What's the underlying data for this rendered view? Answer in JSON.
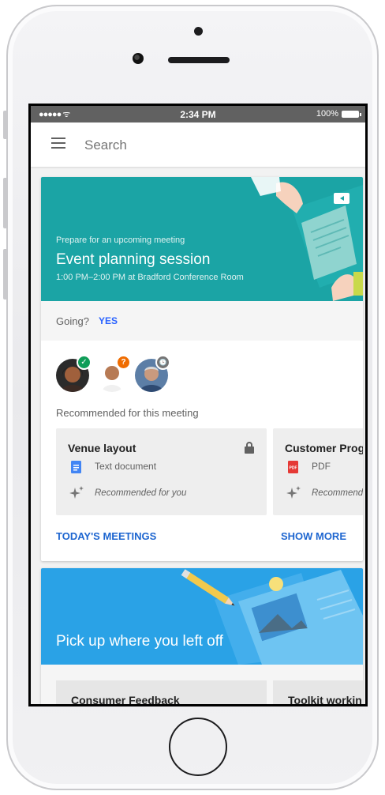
{
  "status_bar": {
    "signal": "●●●●● ᯤ",
    "time": "2:34 PM",
    "battery_pct": "100%"
  },
  "search": {
    "placeholder": "Search"
  },
  "meeting_card": {
    "kicker": "Prepare for an upcoming meeting",
    "title": "Event planning session",
    "subtitle": "1:00 PM–2:00 PM at Bradford Conference Room",
    "going_label": "Going?",
    "going_value": "YES",
    "attendee_badges": [
      "✓",
      "?",
      "🕒"
    ],
    "recommended_label": "Recommended for this meeting",
    "documents": [
      {
        "title": "Venue layout",
        "type": "Text document",
        "note": "Recommended for you",
        "type_icon": "docs-icon",
        "locked": true
      },
      {
        "title": "Customer Prog",
        "type": "PDF",
        "note": "Recommend",
        "type_icon": "pdf-icon",
        "locked": false
      }
    ],
    "actions": {
      "left": "TODAY'S MEETINGS",
      "right": "SHOW MORE"
    },
    "colors": {
      "hero": "#1ba4a5",
      "accent": "#1e66d0"
    }
  },
  "recent_card": {
    "title": "Pick up where you left off",
    "items": [
      "Consumer Feedback",
      "Toolkit workin"
    ],
    "colors": {
      "hero": "#2aa2e6"
    }
  }
}
